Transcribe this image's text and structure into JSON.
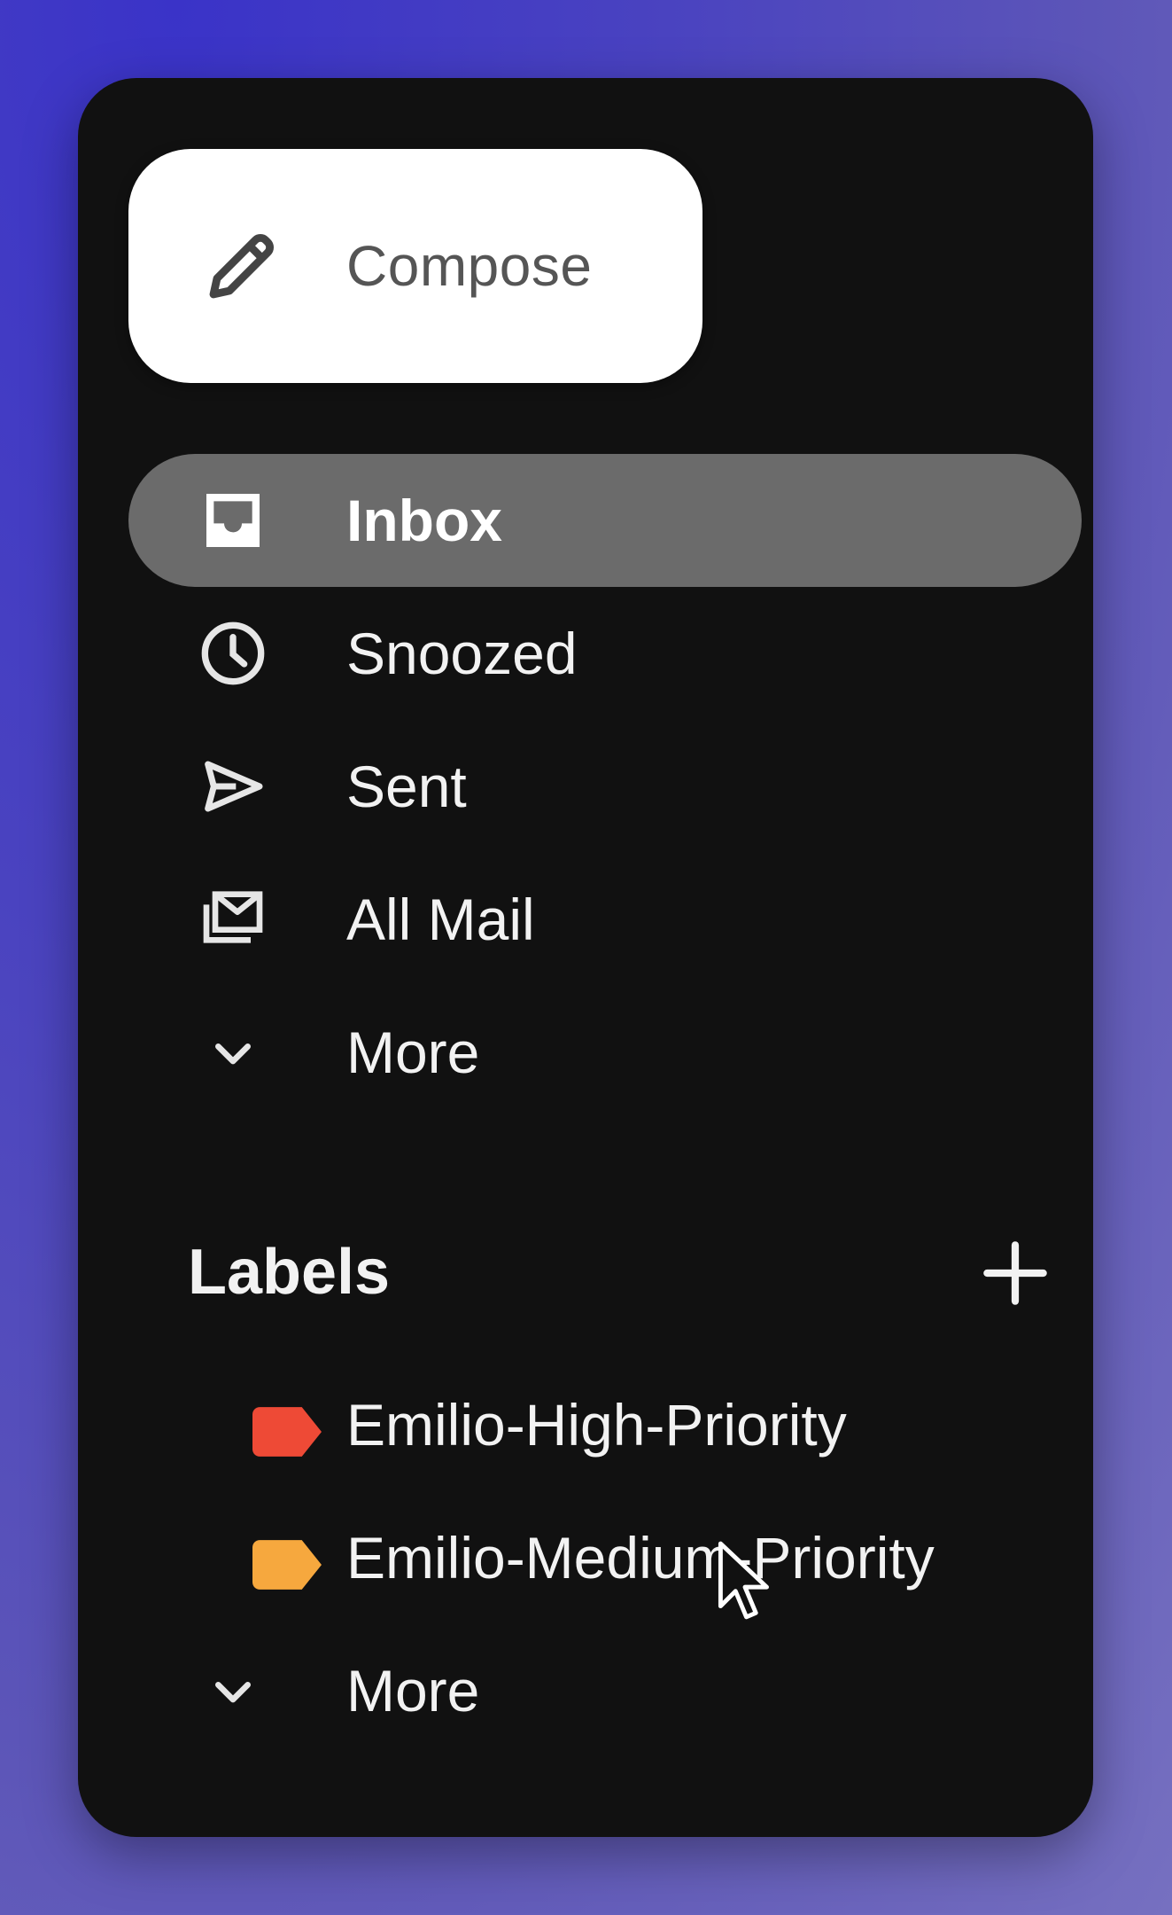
{
  "compose": {
    "label": "Compose",
    "icon": "pencil-icon"
  },
  "nav": {
    "items": [
      {
        "label": "Inbox",
        "icon": "inbox-icon",
        "active": true
      },
      {
        "label": "Snoozed",
        "icon": "clock-icon",
        "active": false
      },
      {
        "label": "Sent",
        "icon": "send-icon",
        "active": false
      },
      {
        "label": "All Mail",
        "icon": "all-mail-icon",
        "active": false
      },
      {
        "label": "More",
        "icon": "chevron-down-icon",
        "active": false
      }
    ]
  },
  "labels": {
    "header": "Labels",
    "add_icon": "plus-icon",
    "items": [
      {
        "label": "Emilio-High-Priority",
        "color": "#ee4a36"
      },
      {
        "label": "Emilio-Medium-Priority",
        "color": "#f6a83e"
      }
    ],
    "more_label": "More"
  },
  "colors": {
    "panel": "#111111",
    "active_item": "#6b6b6b",
    "compose_bg": "#ffffff"
  }
}
